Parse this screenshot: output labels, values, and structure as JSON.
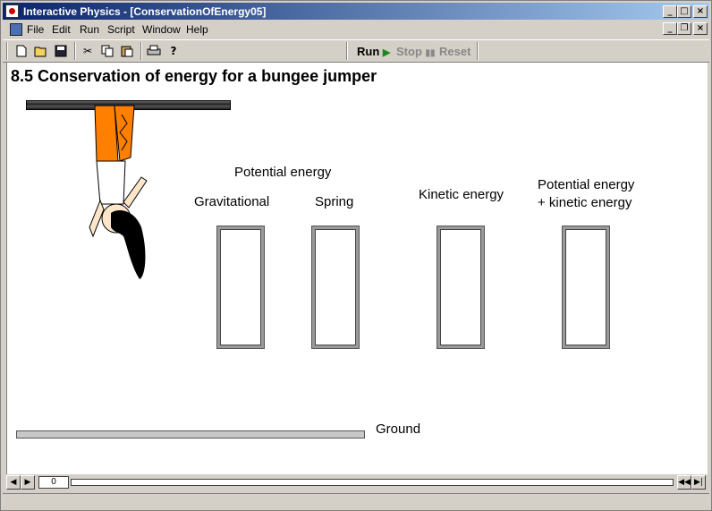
{
  "window": {
    "title": "Interactive Physics - [ConservationOfEnergy05]"
  },
  "menu": {
    "items": [
      "File",
      "Edit",
      "Run",
      "Script",
      "Window",
      "Help"
    ]
  },
  "controls": {
    "run": "Run",
    "stop": "Stop",
    "reset": "Reset"
  },
  "canvas": {
    "heading": "8.5 Conservation of energy for a bungee jumper",
    "potential_energy_label": "Potential energy",
    "gravitational_label": "Gravitational",
    "spring_label": "Spring",
    "kinetic_label": "Kinetic energy",
    "total_label_line1": "Potential energy",
    "total_label_line2": "+ kinetic energy",
    "ground_label": "Ground"
  },
  "meters": {
    "gravitational": 0,
    "spring": 0,
    "kinetic": 0,
    "total": 0
  },
  "playback": {
    "frame": "0"
  },
  "colors": {
    "titlebar_start": "#0a246a",
    "titlebar_end": "#a6caf0",
    "run_arrow": "#1a8a1a",
    "jumper_pants": "#ff7f00"
  }
}
